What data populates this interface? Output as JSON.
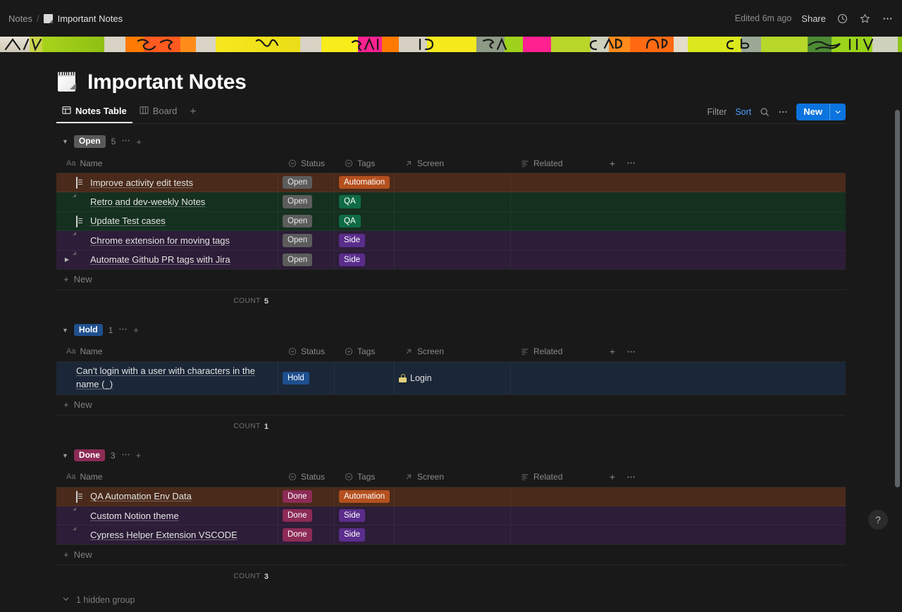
{
  "topbar": {
    "breadcrumb_root": "Notes",
    "breadcrumb_sep": "/",
    "breadcrumb_current": "Important Notes",
    "edited": "Edited 6m ago",
    "share": "Share",
    "icons": [
      "clock-icon",
      "star-icon",
      "more-icon"
    ]
  },
  "page": {
    "title": "Important Notes",
    "icon": "spiral-notepad-icon"
  },
  "views": {
    "tabs": [
      {
        "label": "Notes Table",
        "icon": "table-icon",
        "active": true
      },
      {
        "label": "Board",
        "icon": "board-icon",
        "active": false
      }
    ],
    "add_label": "+",
    "filter": "Filter",
    "sort": "Sort",
    "search_icon": "search-icon",
    "more_icon": "more-icon",
    "new_label": "New",
    "new_caret": "chevron-down-icon",
    "accent": "#0b74de",
    "sort_color": "#4a9eff"
  },
  "columns": [
    {
      "key": "name",
      "label": "Name",
      "icon": "Aa"
    },
    {
      "key": "status",
      "label": "Status",
      "icon": "select-icon"
    },
    {
      "key": "tags",
      "label": "Tags",
      "icon": "select-icon"
    },
    {
      "key": "screen",
      "label": "Screen",
      "icon": "relation-icon"
    },
    {
      "key": "related",
      "label": "Related",
      "icon": "rollup-icon"
    }
  ],
  "add_column": "+",
  "column_more": "...",
  "new_row_label": "New",
  "count_label": "COUNT",
  "hidden_group_label": "1 hidden group",
  "groups": [
    {
      "name": "Open",
      "pill_bg": "#5a5a5a",
      "pill_fg": "#ffffff",
      "count": "5",
      "count_value": "5",
      "rows": [
        {
          "name": "Improve activity edit tests",
          "icon": "document-icon",
          "status": "Open",
          "tag": "Automation",
          "screen": "",
          "related": "",
          "row_bg": "#4a2a1a",
          "status_bg": "#5c5c5c",
          "status_fg": "#e8e8e8",
          "tag_bg": "#b4501e",
          "tag_fg": "#ffffff",
          "expandable": false
        },
        {
          "name": "Retro and dev-weekly Notes",
          "icon": "notepad-icon",
          "status": "Open",
          "tag": "QA",
          "screen": "",
          "related": "",
          "row_bg": "#15301f",
          "status_bg": "#5c5c5c",
          "status_fg": "#e8e8e8",
          "tag_bg": "#0f6b45",
          "tag_fg": "#ffffff",
          "expandable": false
        },
        {
          "name": "Update Test cases",
          "icon": "document-icon",
          "status": "Open",
          "tag": "QA",
          "screen": "",
          "related": "",
          "row_bg": "#15301f",
          "status_bg": "#5c5c5c",
          "status_fg": "#e8e8e8",
          "tag_bg": "#0f6b45",
          "tag_fg": "#ffffff",
          "expandable": false
        },
        {
          "name": "Chrome extension for moving tags",
          "icon": "notepad-icon",
          "status": "Open",
          "tag": "Side",
          "screen": "",
          "related": "",
          "row_bg": "#2d1d38",
          "status_bg": "#5c5c5c",
          "status_fg": "#e8e8e8",
          "tag_bg": "#5a2d8c",
          "tag_fg": "#ffffff",
          "expandable": false
        },
        {
          "name": "Automate Github PR tags with Jira",
          "icon": "notepad-icon",
          "status": "Open",
          "tag": "Side",
          "screen": "",
          "related": "",
          "row_bg": "#2d1d38",
          "status_bg": "#5c5c5c",
          "status_fg": "#e8e8e8",
          "tag_bg": "#5a2d8c",
          "tag_fg": "#ffffff",
          "expandable": true
        }
      ]
    },
    {
      "name": "Hold",
      "pill_bg": "#1f4f8f",
      "pill_fg": "#ffffff",
      "count": "1",
      "count_value": "1",
      "rows": [
        {
          "name": "Can't login with a user with characters in the name (_)",
          "icon": "",
          "status": "Hold",
          "tag": "",
          "screen": "Login",
          "related": "",
          "row_bg": "#1b2738",
          "status_bg": "#1f4f8f",
          "status_fg": "#ffffff",
          "tag_bg": "",
          "tag_fg": "",
          "expandable": false,
          "screen_icon": "lock-icon",
          "tall": true
        }
      ]
    },
    {
      "name": "Done",
      "pill_bg": "#8c2b56",
      "pill_fg": "#ffffff",
      "count": "3",
      "count_value": "3",
      "rows": [
        {
          "name": "QA Automation Env Data",
          "icon": "document-icon",
          "status": "Done",
          "tag": "Automation",
          "screen": "",
          "related": "",
          "row_bg": "#4a2a1a",
          "status_bg": "#8c2b56",
          "status_fg": "#ffffff",
          "tag_bg": "#b4501e",
          "tag_fg": "#ffffff",
          "expandable": false
        },
        {
          "name": "Custom Notion theme",
          "icon": "notepad-icon",
          "status": "Done",
          "tag": "Side",
          "screen": "",
          "related": "",
          "row_bg": "#2d1d38",
          "status_bg": "#8c2b56",
          "status_fg": "#ffffff",
          "tag_bg": "#5a2d8c",
          "tag_fg": "#ffffff",
          "expandable": false
        },
        {
          "name": "Cypress Helper Extension VSCODE",
          "icon": "notepad-icon",
          "status": "Done",
          "tag": "Side",
          "screen": "",
          "related": "",
          "row_bg": "#2d1d38",
          "status_bg": "#8c2b56",
          "status_fg": "#ffffff",
          "tag_bg": "#5a2d8c",
          "tag_fg": "#ffffff",
          "expandable": false
        }
      ]
    }
  ],
  "help_button": "?",
  "cover": {
    "description": "neon sticky notes and graffiti cover photo",
    "colors": [
      "#9ad118",
      "#d6d2c6",
      "#ff7a00",
      "#f5e61a",
      "#ff1f8f",
      "#b3d92a",
      "#7a8a78",
      "#2f8a2f",
      "#e8f02a"
    ]
  }
}
